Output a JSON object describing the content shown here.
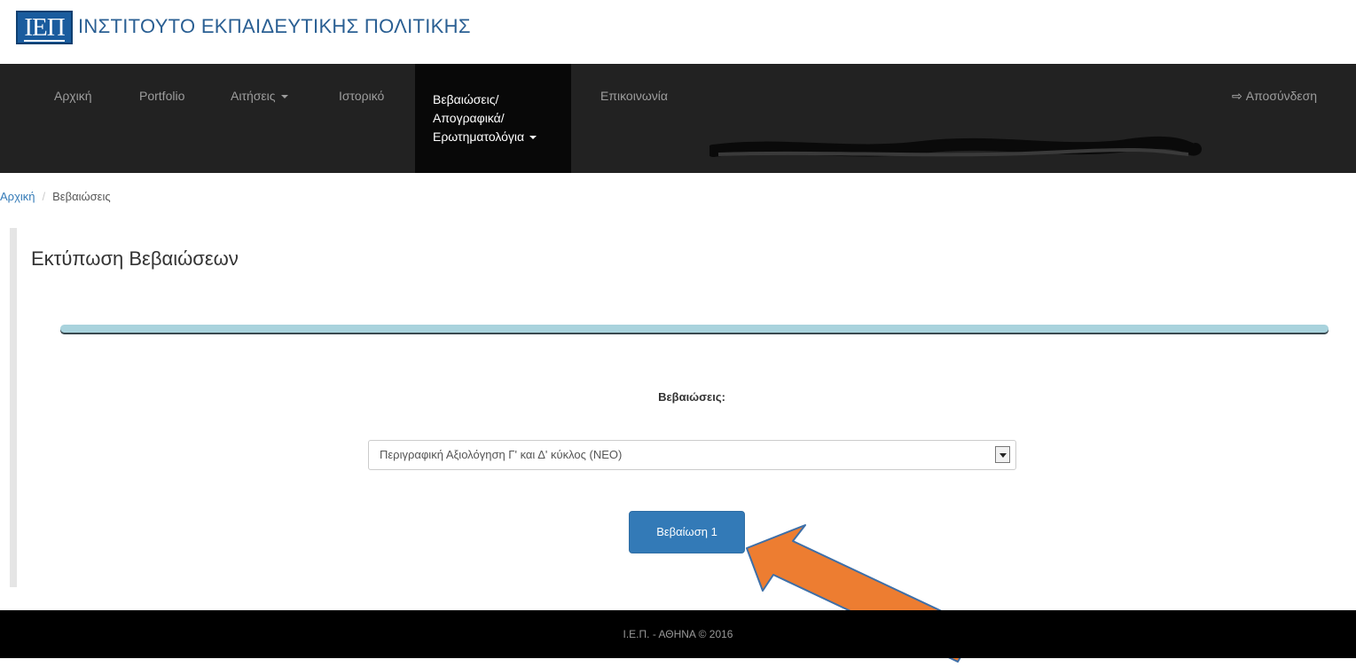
{
  "header": {
    "logo_text": "ΙΕΠ",
    "org_name": "ΙΝΣΤΙΤΟΥΤΟ ΕΚΠΑΙΔΕΥΤΙΚΗΣ ΠΟΛΙΤΙΚΗΣ",
    "brand_color": "#1a5c9e"
  },
  "nav": {
    "items": [
      {
        "label": "Αρχική"
      },
      {
        "label": "Portfolio"
      },
      {
        "label": "Αιτήσεις"
      },
      {
        "label": "Ιστορικό"
      },
      {
        "label_line1": "Βεβαιώσεις/",
        "label_line2": "Απογραφικά/",
        "label_line3": "Ερωτηματολόγια"
      },
      {
        "label": "Επικοινωνία"
      }
    ],
    "logout_label": "Αποσύνδεση",
    "logout_icon": "sign-out-icon"
  },
  "breadcrumb": {
    "home": "Αρχική",
    "current": "Βεβαιώσεις"
  },
  "main": {
    "title": "Εκτύπωση Βεβαιώσεων",
    "field_label": "Βεβαιώσεις:",
    "selected_option": "Περιγραφική Αξιολόγηση Γ' και Δ' κύκλος (ΝΕΟ)",
    "button_label": "Βεβαίωση 1",
    "button_color": "#337ab7",
    "annotation_arrow_color": "#ed7d31"
  },
  "footer": {
    "text": "Ι.Ε.Π. - ΑΘΗΝΑ © 2016"
  }
}
